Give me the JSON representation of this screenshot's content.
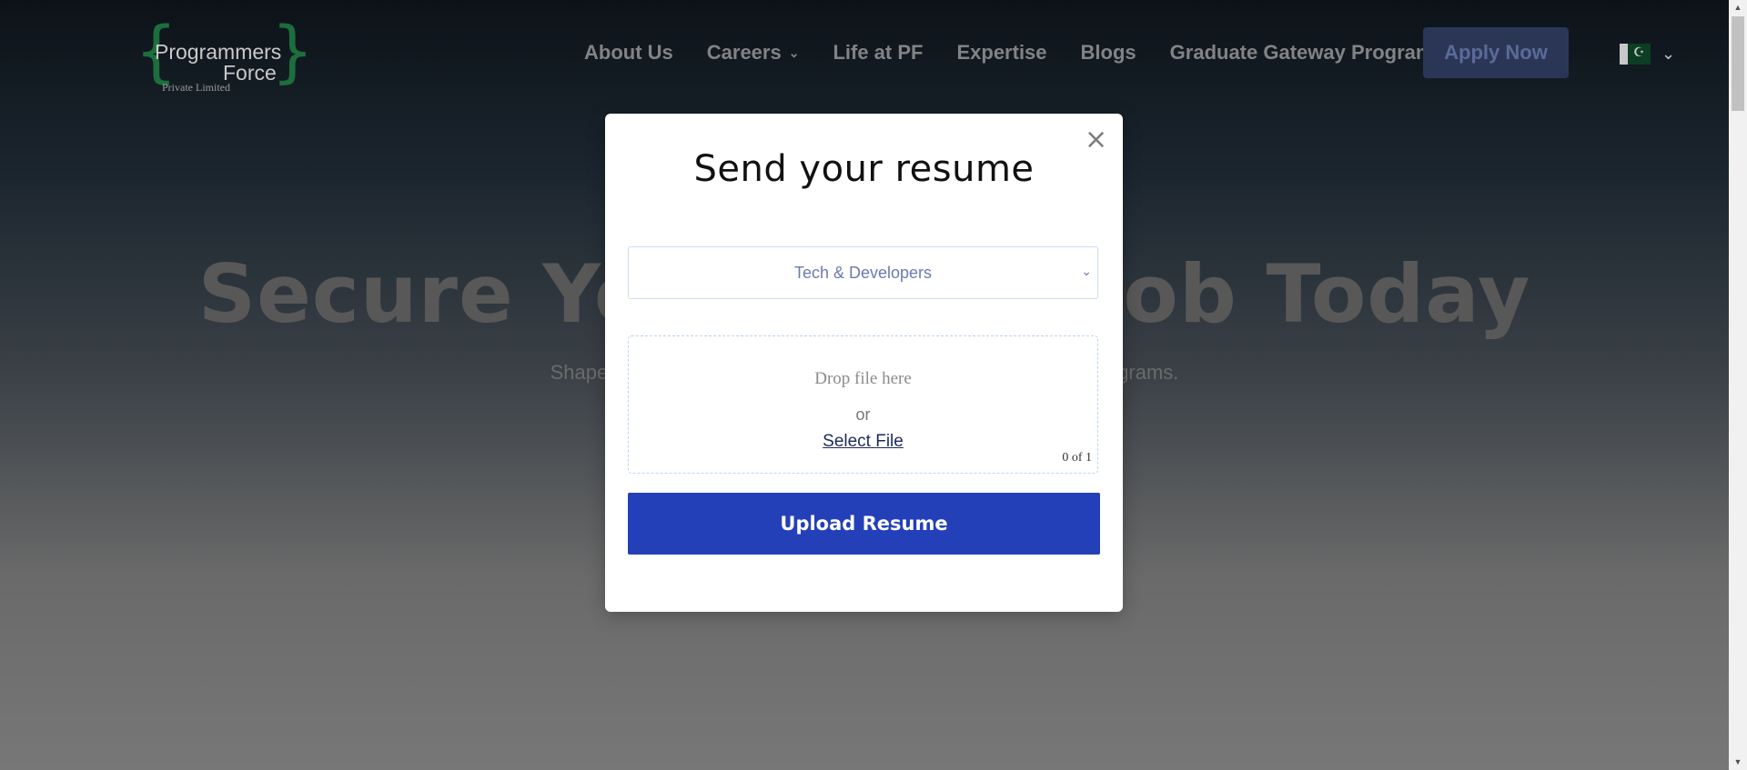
{
  "logo": {
    "word1": "Programmers",
    "word2": "Force",
    "word3": "Private Limited"
  },
  "nav": {
    "items": [
      {
        "label": "About Us"
      },
      {
        "label": "Careers"
      },
      {
        "label": "Life at PF"
      },
      {
        "label": "Expertise"
      },
      {
        "label": "Blogs"
      },
      {
        "label": "Graduate Gateway Program"
      }
    ],
    "apply_label": "Apply Now",
    "language_flag": "pakistan-flag-icon"
  },
  "hero": {
    "title_left": "Secure Yo",
    "title_right": "ob Today",
    "subtitle_left": "Shape",
    "subtitle_right": "grams."
  },
  "modal": {
    "title": "Send your resume",
    "category_value": "Tech & Developers",
    "dropzone": {
      "drop_text": "Drop file here",
      "or_text": "or",
      "select_label": "Select File",
      "count_text": "0 of 1"
    },
    "upload_label": "Upload Resume"
  },
  "colors": {
    "accent": "#2440b8",
    "logo_green": "#1c6e3c",
    "apply_bg": "#2b3657"
  }
}
